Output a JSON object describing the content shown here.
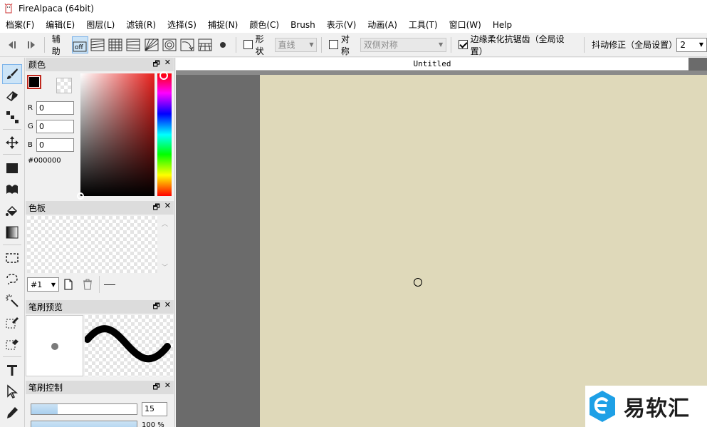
{
  "window": {
    "title": "FireAlpaca (64bit)"
  },
  "menu": [
    "档案(F)",
    "编辑(E)",
    "图层(L)",
    "滤镜(R)",
    "选择(S)",
    "捕捉(N)",
    "颜色(C)",
    "Brush",
    "表示(V)",
    "动画(A)",
    "工具(T)",
    "窗口(W)",
    "Help"
  ],
  "toolbar": {
    "snap_label": "辅助",
    "shape_label": "形状",
    "shape_value": "直线",
    "symmetry_label": "对称",
    "symmetry_value": "双侧对称",
    "antialias_label": "边缘柔化抗锯齿（全局设置）",
    "antialias_checked": true,
    "stabilizer_label": "抖动修正（全局设置）",
    "stabilizer_value": "2"
  },
  "color_panel": {
    "title": "颜色",
    "r_label": "R",
    "r_value": "0",
    "g_label": "G",
    "g_value": "0",
    "b_label": "B",
    "b_value": "0",
    "hex": "#000000",
    "primary_color": "#000000"
  },
  "palette_panel": {
    "title": "色板",
    "select_value": "#1"
  },
  "brush_preview_panel": {
    "title": "笔刷预览"
  },
  "brush_control_panel": {
    "title": "笔刷控制",
    "size_value": "15",
    "opacity_value": "100 %",
    "size_fraction": 0.25
  },
  "document": {
    "tab_title": "Untitled",
    "canvas_color": "#dfd9ba"
  },
  "watermark": {
    "text": "易软汇"
  }
}
